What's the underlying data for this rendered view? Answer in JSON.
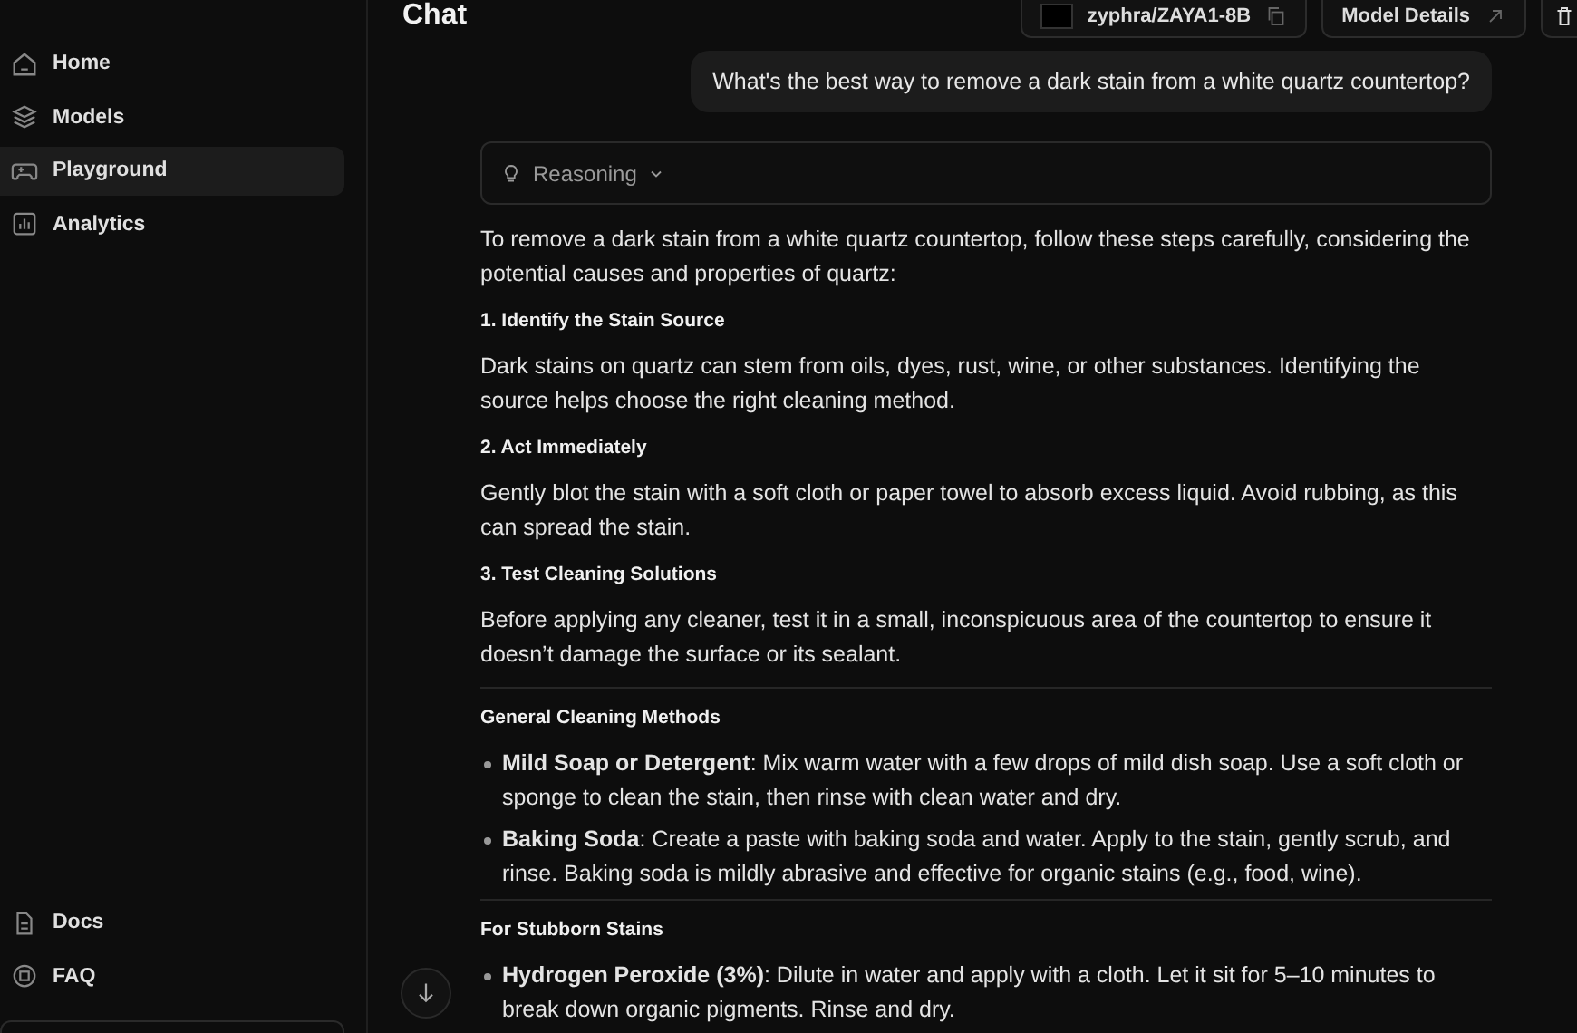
{
  "sidebar": {
    "items": [
      {
        "label": "Home",
        "selected": false
      },
      {
        "label": "Models",
        "selected": false
      },
      {
        "label": "Playground",
        "selected": true
      },
      {
        "label": "Analytics",
        "selected": false
      }
    ],
    "footer_items": [
      {
        "label": "Docs"
      },
      {
        "label": "FAQ"
      }
    ]
  },
  "header": {
    "title": "Chat",
    "model": "zyphra/ZAYA1-8B",
    "details_button": "Model Details"
  },
  "user_message": "What's the best way to remove a dark stain from a white quartz countertop?",
  "reasoning": {
    "label": "Reasoning",
    "expanded": false
  },
  "answer": [
    {
      "kind": "p",
      "text": "To remove a dark stain from a white quartz countertop, follow these steps carefully, considering the potential causes and properties of quartz:"
    },
    {
      "kind": "h",
      "text": "1. Identify the Stain Source"
    },
    {
      "kind": "p",
      "text": "Dark stains on quartz can stem from oils, dyes, rust, wine, or other substances. Identifying the source helps choose the right cleaning method."
    },
    {
      "kind": "h",
      "text": "2. Act Immediately"
    },
    {
      "kind": "p",
      "text": "Gently blot the stain with a soft cloth or paper towel to absorb excess liquid. Avoid rubbing, as this can spread the stain."
    },
    {
      "kind": "h",
      "text": "3. Test Cleaning Solutions"
    },
    {
      "kind": "p",
      "text": "Before applying any cleaner, test it in a small, inconspicuous area of the countertop to ensure it doesn’t damage the surface or its sealant."
    },
    {
      "kind": "rule"
    },
    {
      "kind": "h",
      "text": "General Cleaning Methods"
    },
    {
      "kind": "li",
      "text": "**Mild Soap or Detergent**: Mix warm water with a few drops of mild dish soap. Use a soft cloth or sponge to clean the stain, then rinse with clean water and dry."
    },
    {
      "kind": "li",
      "text": "**Baking Soda**: Create a paste with baking soda and water. Apply to the stain, gently scrub, and rinse. Baking soda is mildly abrasive and effective for organic stains (e.g., food, wine)."
    },
    {
      "kind": "rule"
    },
    {
      "kind": "h",
      "text": "For Stubborn Stains"
    },
    {
      "kind": "li",
      "text": "**Hydrogen Peroxide (3%)**: Dilute in water and apply with a cloth. Let it sit for 5–10 minutes to break down organic pigments. Rinse and dry."
    }
  ]
}
